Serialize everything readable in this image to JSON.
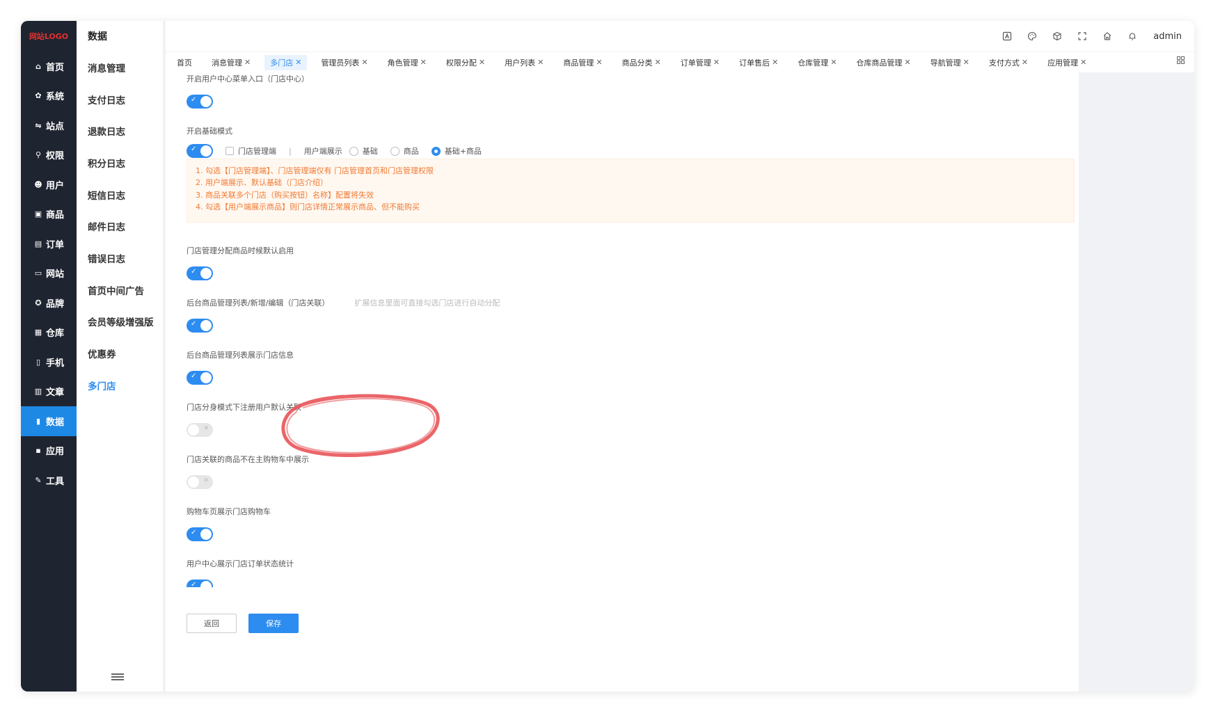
{
  "logo": {
    "part1": "网站",
    "part2": "LOGO"
  },
  "nav": [
    {
      "icon": "home-icon",
      "glyph": "⌂",
      "label": "首页"
    },
    {
      "icon": "gear-icon",
      "glyph": "✿",
      "label": "系统"
    },
    {
      "icon": "sliders-icon",
      "glyph": "⇋",
      "label": "站点"
    },
    {
      "icon": "user-key-icon",
      "glyph": "⚲",
      "label": "权限"
    },
    {
      "icon": "user-icon",
      "glyph": "☻",
      "label": "用户"
    },
    {
      "icon": "goods-icon",
      "glyph": "▣",
      "label": "商品"
    },
    {
      "icon": "order-icon",
      "glyph": "▤",
      "label": "订单"
    },
    {
      "icon": "monitor-icon",
      "glyph": "▭",
      "label": "网站"
    },
    {
      "icon": "brand-icon",
      "glyph": "✪",
      "label": "品牌"
    },
    {
      "icon": "warehouse-icon",
      "glyph": "▦",
      "label": "仓库"
    },
    {
      "icon": "phone-icon",
      "glyph": "▯",
      "label": "手机"
    },
    {
      "icon": "article-icon",
      "glyph": "▥",
      "label": "文章"
    },
    {
      "icon": "chart-icon",
      "glyph": "▮",
      "label": "数据",
      "active": true
    },
    {
      "icon": "apps-icon",
      "glyph": "▪",
      "label": "应用"
    },
    {
      "icon": "tool-icon",
      "glyph": "✎",
      "label": "工具"
    }
  ],
  "sub": {
    "title": "数据",
    "items": [
      "消息管理",
      "支付日志",
      "退款日志",
      "积分日志",
      "短信日志",
      "邮件日志",
      "错误日志",
      "首页中间广告",
      "会员等级增强版",
      "优惠券",
      "多门店"
    ],
    "active_index": 10
  },
  "topbar": {
    "icons": [
      "translate-icon",
      "palette-icon",
      "cube-icon",
      "fullscreen-icon",
      "house-icon",
      "bell-icon"
    ],
    "user": "admin"
  },
  "tabs": [
    {
      "label": "首页",
      "closable": false
    },
    {
      "label": "消息管理",
      "closable": true
    },
    {
      "label": "多门店",
      "closable": true,
      "active": true
    },
    {
      "label": "管理员列表",
      "closable": true
    },
    {
      "label": "角色管理",
      "closable": true
    },
    {
      "label": "权限分配",
      "closable": true
    },
    {
      "label": "用户列表",
      "closable": true
    },
    {
      "label": "商品管理",
      "closable": true
    },
    {
      "label": "商品分类",
      "closable": true
    },
    {
      "label": "订单管理",
      "closable": true
    },
    {
      "label": "订单售后",
      "closable": true
    },
    {
      "label": "仓库管理",
      "closable": true
    },
    {
      "label": "仓库商品管理",
      "closable": true
    },
    {
      "label": "导航管理",
      "closable": true
    },
    {
      "label": "支付方式",
      "closable": true
    },
    {
      "label": "应用管理",
      "closable": true
    }
  ],
  "form": {
    "f1": {
      "label": "开启用户中心菜单入口（门店中心）",
      "on": true
    },
    "f2": {
      "label": "开启基础模式",
      "on": true,
      "checkbox": "门店管理端",
      "sep": "|",
      "display_label": "用户端展示",
      "radios": [
        "基础",
        "商品",
        "基础+商品"
      ],
      "selected": 2
    },
    "tips": [
      "1. 勾选【门店管理端】、门店管理端仅有 门店管理首页和门店管理权限",
      "2. 用户端展示、默认基础（门店介绍）",
      "3. 商品关联多个门店（购买按钮）名称】配置将失效",
      "4. 勾选【用户端展示商品】则门店详情正常展示商品、但不能购买"
    ],
    "f3": {
      "label": "门店管理分配商品时候默认启用",
      "on": true
    },
    "f4": {
      "label": "后台商品管理列表/新增/编辑（门店关联）",
      "hint": "扩展信息里面可直接勾选门店进行自动分配",
      "on": true
    },
    "f5": {
      "label": "后台商品管理列表展示门店信息",
      "on": true
    },
    "f6": {
      "label": "门店分身模式下注册用户默认关联",
      "on": false
    },
    "f7": {
      "label": "门店关联的商品不在主购物车中展示",
      "on": false
    },
    "f8": {
      "label": "购物车页展示门店购物车",
      "on": true
    },
    "f9": {
      "label": "用户中心展示门店订单状态统计",
      "on": true
    }
  },
  "buttons": {
    "back": "返回",
    "save": "保存"
  },
  "colors": {
    "accent": "#2d8cf0",
    "nav_bg": "#1f2431",
    "tip_text": "#f07a32",
    "annotation": "#e8585c"
  }
}
